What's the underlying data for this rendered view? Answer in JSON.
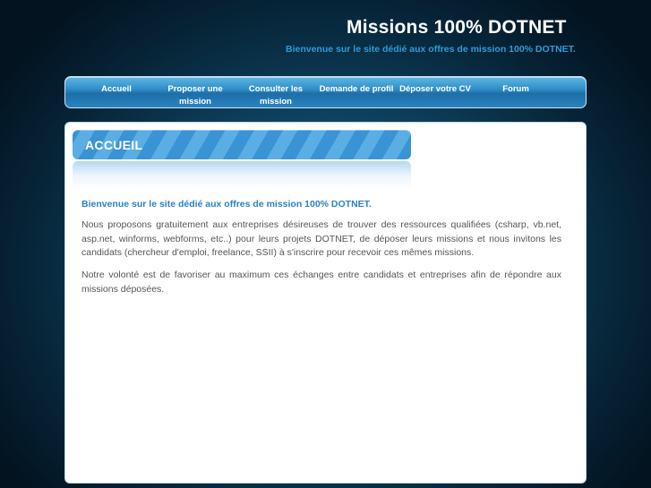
{
  "header": {
    "title": "Missions 100% DOTNET",
    "subtitle": "Bienvenue sur le site dédié aux offres de mission 100% DOTNET."
  },
  "nav": {
    "items": [
      {
        "label": "Accueil"
      },
      {
        "label": "Proposer une mission"
      },
      {
        "label": "Consulter les mission"
      },
      {
        "label": "Demande de profil"
      },
      {
        "label": "Déposer votre CV"
      },
      {
        "label": "Forum"
      }
    ]
  },
  "main": {
    "heading": "ACCUEIL",
    "intro": "Bienvenue sur le site dédié aux offres de mission 100% DOTNET.",
    "paragraphs": [
      "Nous proposons gratuitement aux entreprises désireuses de trouver des ressources qualifiées (csharp, vb.net, asp.net, winforms, webforms, etc..) pour leurs projets DOTNET, de déposer leurs missions et nous invitons les candidats (chercheur d'emploi, freelance, SSII) à s'inscrire pour recevoir ces mêmes missions.",
      "Notre volonté est de favoriser au maximum ces échanges entre candidats et entreprises afin de répondre aux missions déposées."
    ]
  },
  "colors": {
    "accent": "#2a83c4",
    "subtitle": "#2f9ad8",
    "nav_bar": "#2f8ec8",
    "background": "#0f4664"
  }
}
